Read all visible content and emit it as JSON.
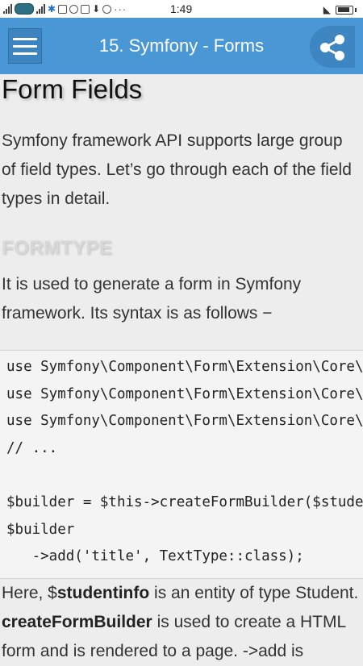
{
  "status_bar": {
    "time": "1:49",
    "dots": "···",
    "icons": [
      "signal-icon",
      "carrier-badge-icon",
      "signal-icon",
      "network-icon",
      "image-icon",
      "instagram-icon",
      "mail-icon",
      "download-icon",
      "skype-icon",
      "wifi-icon",
      "battery-icon"
    ]
  },
  "app_bar": {
    "title": "15. Symfony - Forms",
    "menu_icon": "hamburger-menu-icon",
    "share_icon": "share-icon",
    "color": "#4a97d6"
  },
  "article": {
    "heading": "Form Fields",
    "intro": [
      "Symfony framework API supports large group",
      "of field types. Let’s go through each of the field",
      "types in detail."
    ],
    "section_heading": "FORMTYPE",
    "section_text": [
      "It is used to generate a form in Symfony",
      "framework. Its syntax is as follows −"
    ],
    "code_lines": [
      "use Symfony\\Component\\Form\\Extension\\Core\\Type\\TextType;",
      "use Symfony\\Component\\Form\\Extension\\Core\\Type\\TextareaType;",
      "use Symfony\\Component\\Form\\Extension\\Core\\Type\\EmailType;",
      "// ...",
      "",
      "$builder = $this->createFormBuilder($studentinfo);",
      "$builder",
      "   ->add('title', TextType::class);"
    ],
    "after": {
      "l1_pre": "Here, $",
      "l1_bold": "studentinfo",
      "l1_post": " is an entity of type Student.",
      "l2_bold": "createFormBuilder",
      "l2_post": " is used to create a HTML",
      "l3": "form and is rendered to a page. ->add is"
    }
  }
}
